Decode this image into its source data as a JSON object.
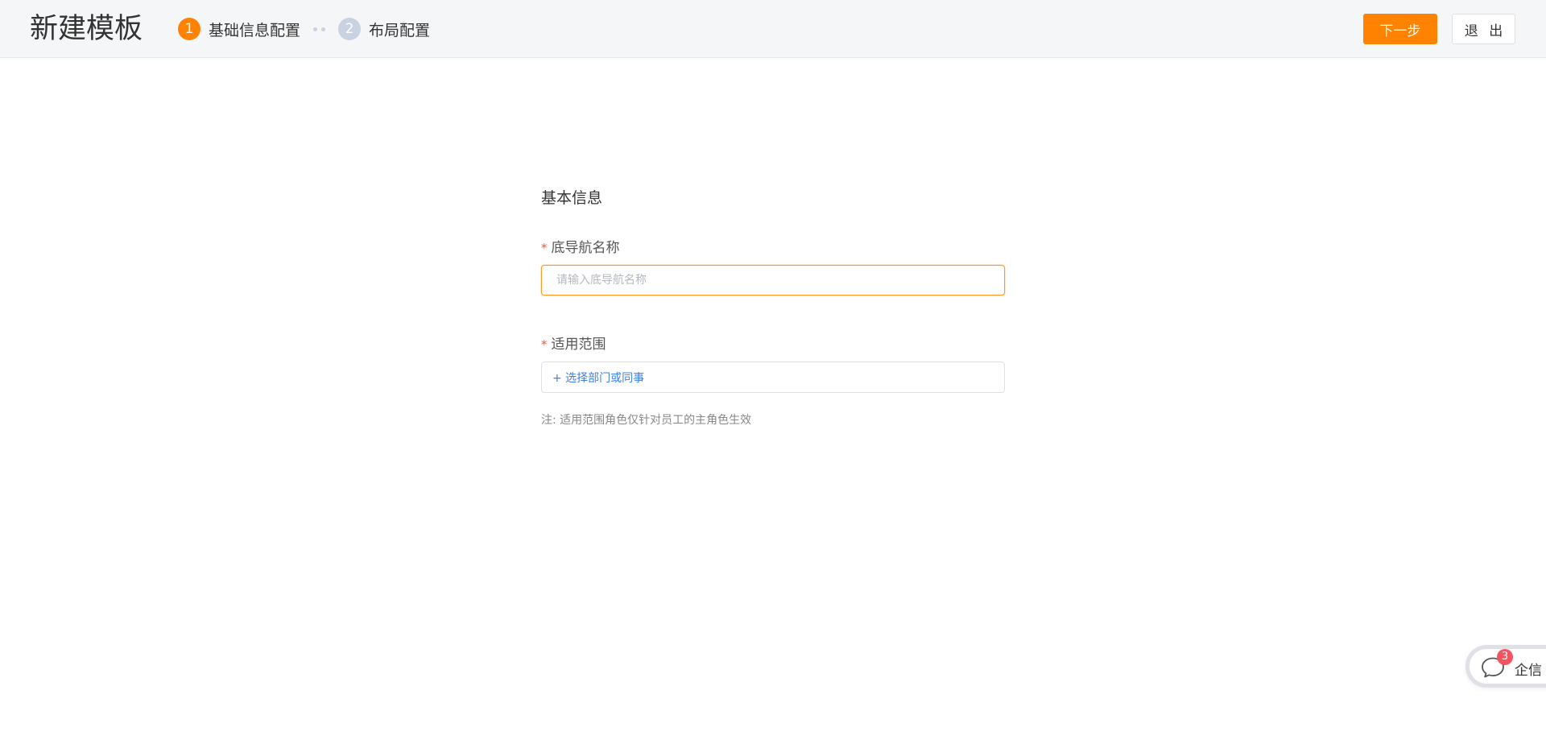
{
  "header": {
    "title": "新建模板",
    "steps": [
      {
        "number": "1",
        "label": "基础信息配置",
        "state": "active"
      },
      {
        "number": "2",
        "label": "布局配置",
        "state": "inactive"
      }
    ],
    "next_label": "下一步",
    "exit_label": "退 出"
  },
  "form": {
    "section_title": "基本信息",
    "nav_name": {
      "required_mark": "*",
      "label": "底导航名称",
      "placeholder": "请输入底导航名称",
      "value": ""
    },
    "scope": {
      "required_mark": "*",
      "label": "适用范围",
      "add_label": "+ 选择部门或同事"
    },
    "note": "注: 适用范围角色仅针对员工的主角色生效"
  },
  "chat": {
    "icon": "chat-bubble-icon",
    "badge_count": "3",
    "label": "企信"
  },
  "colors": {
    "accent": "#ff8200",
    "step_inactive": "#c9d2e0",
    "link": "#3f7ee8",
    "required": "#f05b41",
    "badge": "#f4545f"
  }
}
